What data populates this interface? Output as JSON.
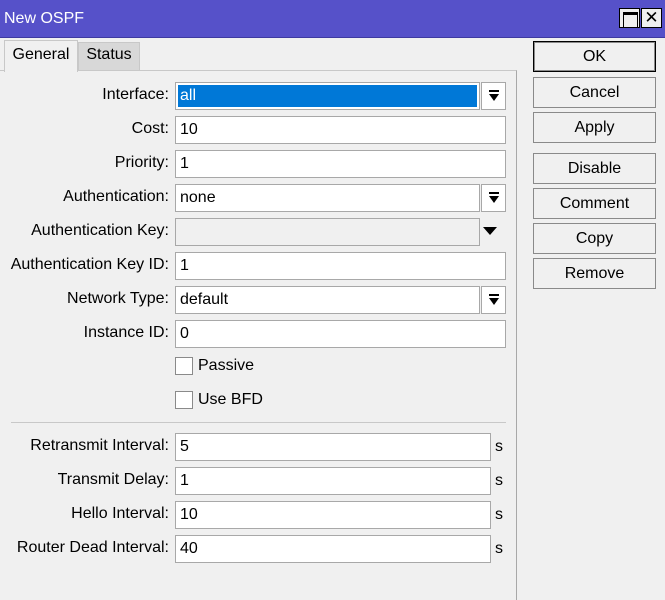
{
  "window": {
    "title": "New OSPF",
    "maximize_glyph": "",
    "close_glyph": "✕"
  },
  "tabs": [
    {
      "label": "General"
    },
    {
      "label": "Status"
    }
  ],
  "form": {
    "interface": {
      "label": "Interface:",
      "value": "all"
    },
    "cost": {
      "label": "Cost:",
      "value": "10"
    },
    "priority": {
      "label": "Priority:",
      "value": "1"
    },
    "authentication": {
      "label": "Authentication:",
      "value": "none"
    },
    "authentication_key": {
      "label": "Authentication Key:",
      "value": ""
    },
    "authentication_key_id": {
      "label": "Authentication Key ID:",
      "value": "1"
    },
    "network_type": {
      "label": "Network Type:",
      "value": "default"
    },
    "instance_id": {
      "label": "Instance ID:",
      "value": "0"
    },
    "passive": {
      "label": "Passive",
      "checked": false
    },
    "use_bfd": {
      "label": "Use BFD",
      "checked": false
    },
    "retransmit_interval": {
      "label": "Retransmit Interval:",
      "value": "5",
      "unit": "s"
    },
    "transmit_delay": {
      "label": "Transmit Delay:",
      "value": "1",
      "unit": "s"
    },
    "hello_interval": {
      "label": "Hello Interval:",
      "value": "10",
      "unit": "s"
    },
    "router_dead_interval": {
      "label": "Router Dead Interval:",
      "value": "40",
      "unit": "s"
    }
  },
  "buttons": {
    "ok": "OK",
    "cancel": "Cancel",
    "apply": "Apply",
    "disable": "Disable",
    "comment": "Comment",
    "copy": "Copy",
    "remove": "Remove"
  },
  "icons": {
    "dropdown": "dropdown-arrow-icon",
    "maximize": "maximize-icon",
    "close": "close-icon"
  },
  "colors": {
    "titlebar": "#5651c9",
    "selection": "#0078d7",
    "background": "#f0f0f0"
  }
}
